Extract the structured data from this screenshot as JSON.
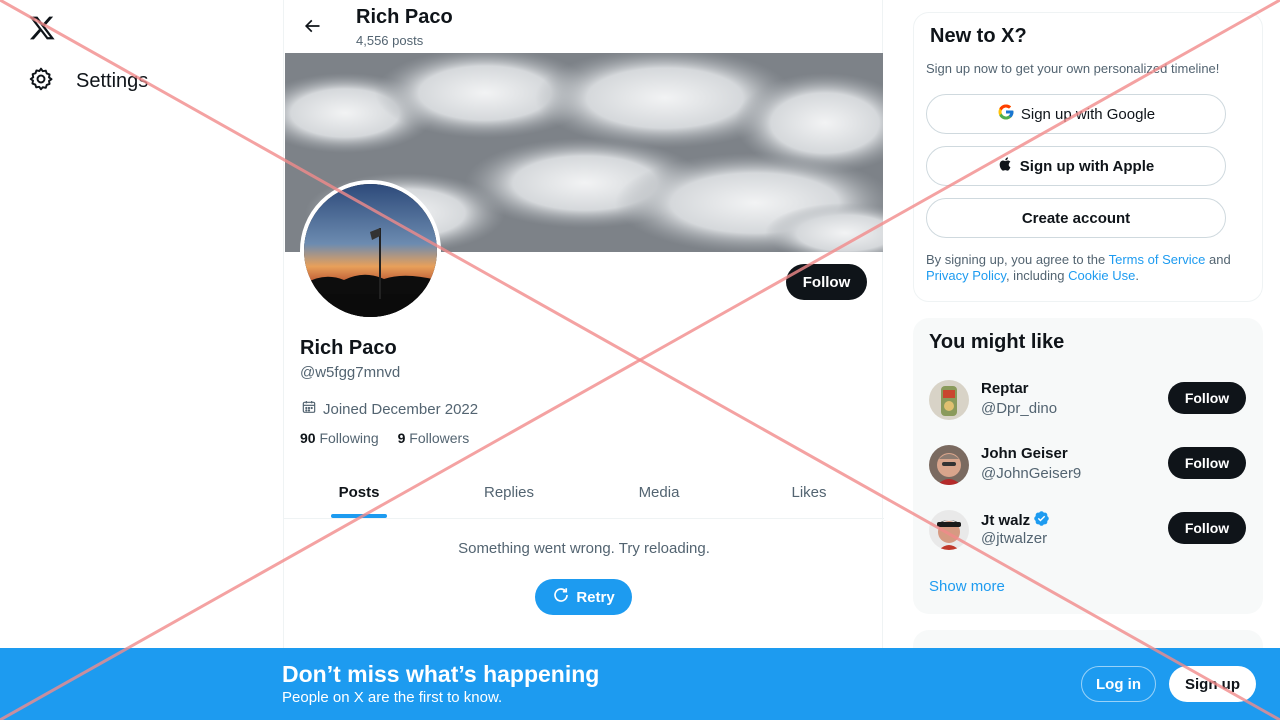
{
  "nav": {
    "settings_label": "Settings"
  },
  "header": {
    "name": "Rich Paco",
    "posts_count": "4,556 posts"
  },
  "profile": {
    "name": "Rich Paco",
    "handle": "@w5fgg7mnvd",
    "joined": "Joined December 2022",
    "following_count": "90",
    "following_label": "Following",
    "followers_count": "9",
    "followers_label": "Followers",
    "follow_label": "Follow"
  },
  "tabs": [
    {
      "label": "Posts",
      "active": true
    },
    {
      "label": "Replies",
      "active": false
    },
    {
      "label": "Media",
      "active": false
    },
    {
      "label": "Likes",
      "active": false
    }
  ],
  "feed": {
    "error_message": "Something went wrong. Try reloading.",
    "retry_label": "Retry"
  },
  "signup_card": {
    "title": "New to X?",
    "subtitle": "Sign up now to get your own personalized timeline!",
    "google_label": "Sign up with Google",
    "apple_label": "Sign up with Apple",
    "create_label": "Create account",
    "legal_prefix": "By signing up, you agree to the ",
    "terms": "Terms of Service",
    "and": " and ",
    "privacy": "Privacy Policy",
    "including": ", including ",
    "cookie": "Cookie Use",
    "period": "."
  },
  "might_like": {
    "title": "You might like",
    "users": [
      {
        "name": "Reptar",
        "handle": "@Dpr_dino",
        "verified": false,
        "follow_label": "Follow"
      },
      {
        "name": "John Geiser",
        "handle": "@JohnGeiser9",
        "verified": false,
        "follow_label": "Follow"
      },
      {
        "name": "Jt walz",
        "handle": "@jtwalzer",
        "verified": true,
        "follow_label": "Follow"
      }
    ],
    "show_more": "Show more"
  },
  "bottom_bar": {
    "title": "Don’t miss what’s happening",
    "subtitle": "People on X are the first to know.",
    "login_label": "Log in",
    "signup_label": "Sign up"
  },
  "colors": {
    "accent": "#1d9bf0",
    "text_primary": "#0f1419",
    "text_secondary": "#536471",
    "overlay_x": "#f28b8b"
  }
}
